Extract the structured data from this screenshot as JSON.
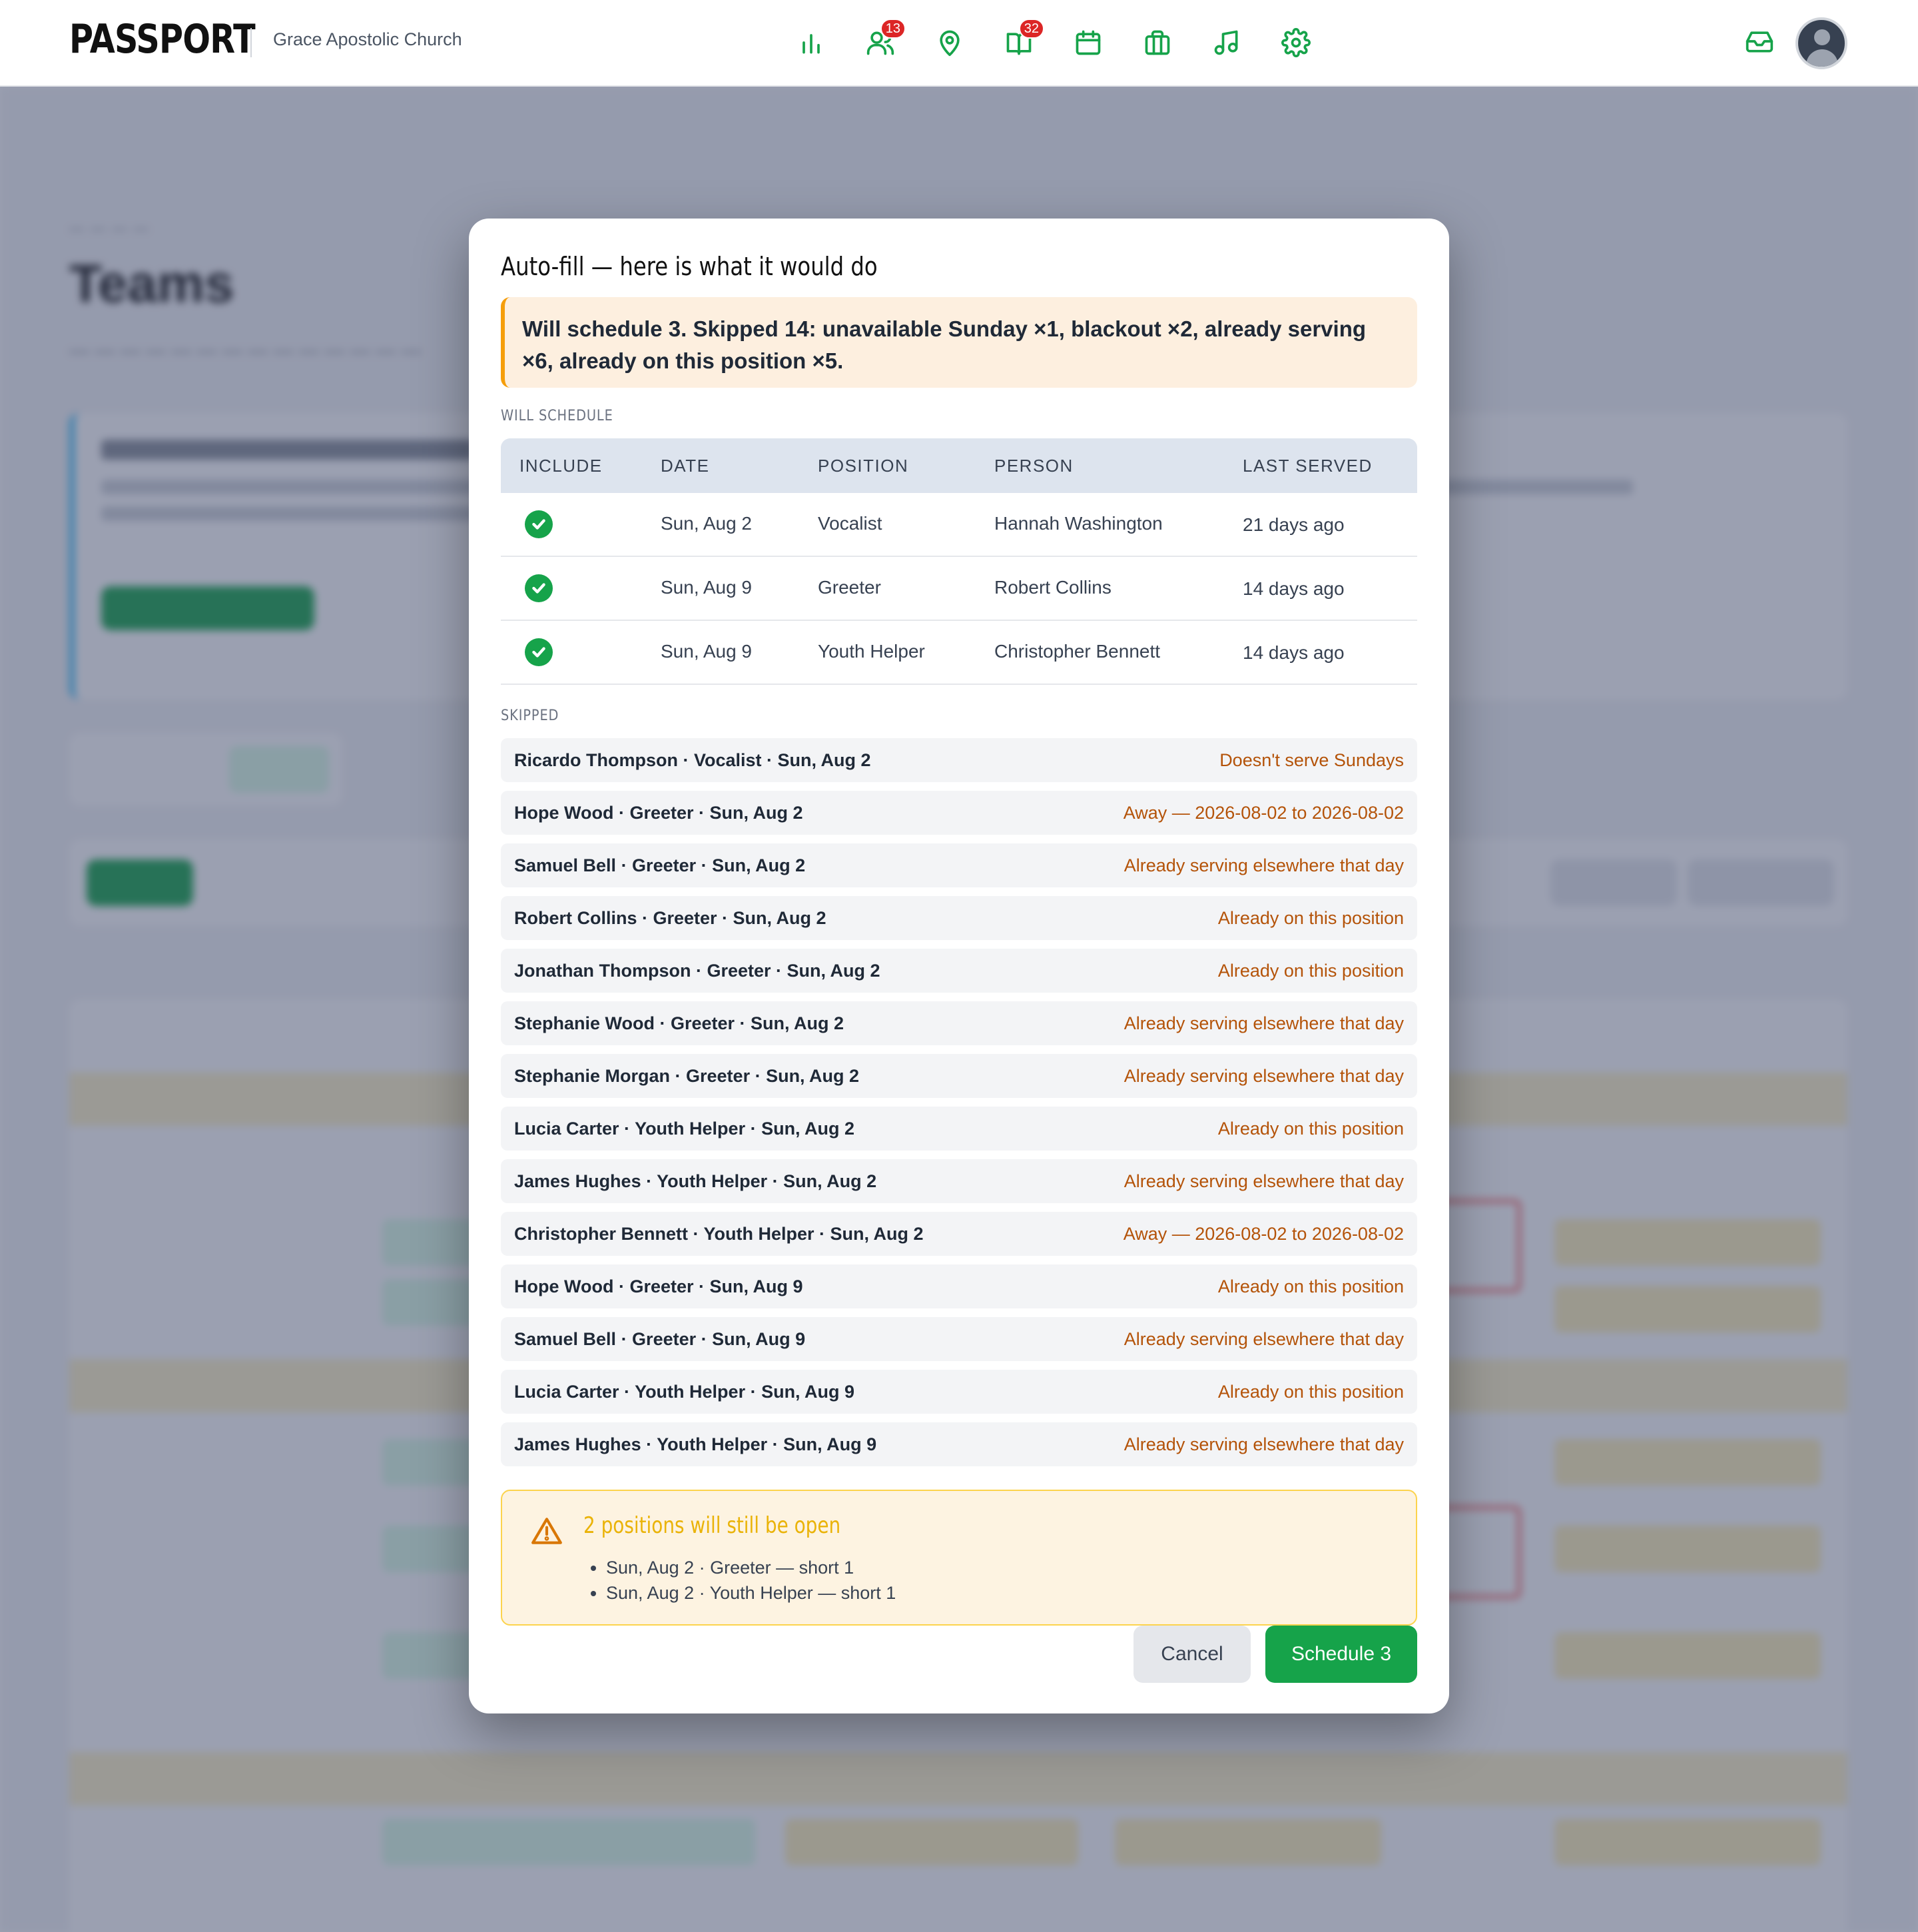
{
  "header": {
    "logo_text": "PASSPORT",
    "church_name": "Grace Apostolic Church",
    "nav": [
      {
        "icon": "bar-chart-icon",
        "badge": ""
      },
      {
        "icon": "users-icon",
        "badge": "13"
      },
      {
        "icon": "map-pin-icon",
        "badge": ""
      },
      {
        "icon": "book-open-icon",
        "badge": "32"
      },
      {
        "icon": "calendar-icon",
        "badge": ""
      },
      {
        "icon": "briefcase-icon",
        "badge": ""
      },
      {
        "icon": "music-icon",
        "badge": ""
      },
      {
        "icon": "gear-icon",
        "badge": ""
      }
    ],
    "inbox_icon": "inbox-icon",
    "avatar_icon": "user-avatar-icon",
    "accent_color": "#16a34a",
    "badge_color": "#dc2626"
  },
  "background_page": {
    "title": "Teams"
  },
  "modal": {
    "title": "Auto-fill — here is what it would do",
    "summary": "Will schedule 3. Skipped 14: unavailable Sunday ×1, blackout ×2, already serving ×6, already on this position ×5.",
    "will_schedule_label": "WILL SCHEDULE",
    "columns": {
      "include": "INCLUDE",
      "date": "DATE",
      "position": "POSITION",
      "person": "PERSON",
      "last_served": "LAST SERVED"
    },
    "rows": [
      {
        "date": "Sun, Aug 2",
        "position": "Vocalist",
        "person": "Hannah Washington",
        "last_served": "21 days ago",
        "included": true
      },
      {
        "date": "Sun, Aug 9",
        "position": "Greeter",
        "person": "Robert Collins",
        "last_served": "14 days ago",
        "included": true
      },
      {
        "date": "Sun, Aug 9",
        "position": "Youth Helper",
        "person": "Christopher Bennett",
        "last_served": "14 days ago",
        "included": true
      }
    ],
    "skipped_label": "SKIPPED",
    "skipped": [
      {
        "who": "Ricardo Thompson · Vocalist · Sun, Aug 2",
        "reason": "Doesn't serve Sundays"
      },
      {
        "who": "Hope Wood · Greeter · Sun, Aug 2",
        "reason": "Away — 2026-08-02 to 2026-08-02"
      },
      {
        "who": "Samuel Bell · Greeter · Sun, Aug 2",
        "reason": "Already serving elsewhere that day"
      },
      {
        "who": "Robert Collins · Greeter · Sun, Aug 2",
        "reason": "Already on this position"
      },
      {
        "who": "Jonathan Thompson · Greeter · Sun, Aug 2",
        "reason": "Already on this position"
      },
      {
        "who": "Stephanie Wood · Greeter · Sun, Aug 2",
        "reason": "Already serving elsewhere that day"
      },
      {
        "who": "Stephanie Morgan · Greeter · Sun, Aug 2",
        "reason": "Already serving elsewhere that day"
      },
      {
        "who": "Lucia Carter · Youth Helper · Sun, Aug 2",
        "reason": "Already on this position"
      },
      {
        "who": "James Hughes · Youth Helper · Sun, Aug 2",
        "reason": "Already serving elsewhere that day"
      },
      {
        "who": "Christopher Bennett · Youth Helper · Sun, Aug 2",
        "reason": "Away — 2026-08-02 to 2026-08-02"
      },
      {
        "who": "Hope Wood · Greeter · Sun, Aug 9",
        "reason": "Already on this position"
      },
      {
        "who": "Samuel Bell · Greeter · Sun, Aug 9",
        "reason": "Already serving elsewhere that day"
      },
      {
        "who": "Lucia Carter · Youth Helper · Sun, Aug 9",
        "reason": "Already on this position"
      },
      {
        "who": "James Hughes · Youth Helper · Sun, Aug 9",
        "reason": "Already serving elsewhere that day"
      }
    ],
    "warning": {
      "icon": "warning-triangle-icon",
      "title": "2 positions will still be open",
      "items": [
        "Sun, Aug 2 · Greeter — short 1",
        "Sun, Aug 2 · Youth Helper — short 1"
      ]
    },
    "cancel_label": "Cancel",
    "confirm_label": "Schedule 3"
  }
}
